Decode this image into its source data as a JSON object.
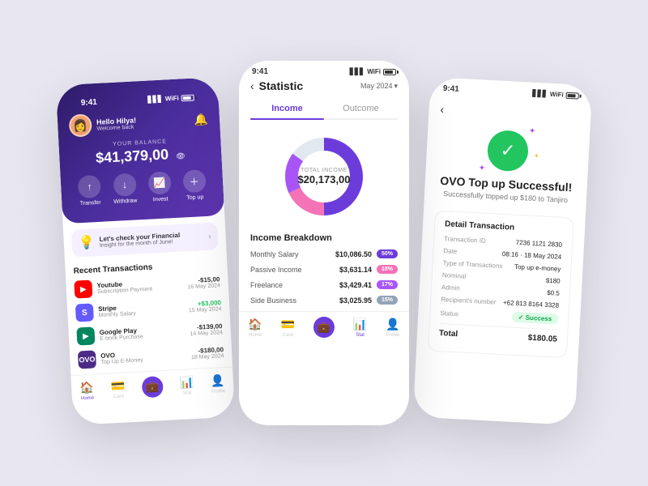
{
  "app": {
    "background": "#e8e6f0"
  },
  "left_phone": {
    "status_time": "9:41",
    "user": {
      "greeting": "Hello Hilya!",
      "sub": "Welcome back",
      "avatar_emoji": "👩"
    },
    "balance": {
      "label": "YOUR BALANCE",
      "amount": "$41,379,00",
      "eye_icon": "👁"
    },
    "actions": [
      {
        "icon": "↑",
        "label": "Transfer"
      },
      {
        "icon": "↓",
        "label": "Withdraw"
      },
      {
        "icon": "📈",
        "label": "Invest"
      },
      {
        "icon": "+",
        "label": "Top up"
      }
    ],
    "insight": {
      "title": "Let's check your Financial",
      "sub": "Insight for the month of June!"
    },
    "recent_title": "Recent Transactions",
    "transactions": [
      {
        "name": "Youtube",
        "sub": "Subscription Payment",
        "amount": "-$15,00",
        "date": "16 May 2024",
        "positive": false,
        "icon": "▶",
        "icon_bg": "#ff0000",
        "icon_color": "#fff"
      },
      {
        "name": "Stripe",
        "sub": "Monthly Salary",
        "amount": "+$3,000",
        "date": "15 May 2024",
        "positive": true,
        "icon": "S",
        "icon_bg": "#635bff",
        "icon_color": "#fff"
      },
      {
        "name": "Google Play",
        "sub": "E-book Purchase",
        "amount": "-$139,00",
        "date": "14 May 2024",
        "positive": false,
        "icon": "▶",
        "icon_bg": "#01875f",
        "icon_color": "#fff"
      },
      {
        "name": "OVO",
        "sub": "Top Up E-Money",
        "amount": "-$180,00",
        "date": "18 May 2024",
        "positive": false,
        "icon": "O",
        "icon_bg": "#4c2a85",
        "icon_color": "#fff"
      }
    ],
    "nav": [
      {
        "icon": "🏠",
        "label": "Home",
        "active": true
      },
      {
        "icon": "💳",
        "label": "Card",
        "active": false
      },
      {
        "icon": "💼",
        "label": "",
        "active": false,
        "wallet": true
      },
      {
        "icon": "📊",
        "label": "Stat",
        "active": false
      },
      {
        "icon": "👤",
        "label": "Profile",
        "active": false
      }
    ]
  },
  "center_phone": {
    "status_time": "9:41",
    "back_label": "‹",
    "title": "Statistic",
    "month": "May 2024",
    "tabs": [
      {
        "label": "Income",
        "active": true
      },
      {
        "label": "Outcome",
        "active": false
      }
    ],
    "donut": {
      "label": "TOTAL INCOME",
      "value": "$20,173,00",
      "segments": [
        {
          "color": "#6c3cdb",
          "percent": 50
        },
        {
          "color": "#f472b6",
          "percent": 18
        },
        {
          "color": "#a855f7",
          "percent": 17
        },
        {
          "color": "#e2e8f0",
          "percent": 15
        }
      ]
    },
    "breakdown_title": "Income Breakdown",
    "breakdown": [
      {
        "name": "Monthly Salary",
        "amount": "$10,086.50",
        "badge": "50%",
        "badge_color": "badge-blue"
      },
      {
        "name": "Passive Income",
        "amount": "$3,631.14",
        "badge": "18%",
        "badge_color": "badge-pink"
      },
      {
        "name": "Freelance",
        "amount": "$3,429.41",
        "badge": "17%",
        "badge_color": "badge-purple"
      },
      {
        "name": "Side Business",
        "amount": "$3,025.95",
        "badge": "15%",
        "badge_color": "badge-gray"
      }
    ],
    "nav": [
      {
        "icon": "🏠",
        "label": "Home",
        "active": false
      },
      {
        "icon": "💳",
        "label": "Card",
        "active": false
      },
      {
        "icon": "💼",
        "label": "",
        "active": false,
        "wallet": true
      },
      {
        "icon": "📊",
        "label": "Stat",
        "active": true
      },
      {
        "icon": "👤",
        "label": "Profile",
        "active": false
      }
    ]
  },
  "right_phone": {
    "status_time": "9:41",
    "back_label": "‹",
    "success_icon": "✓",
    "sparkles": [
      "✦",
      "✦",
      "✦"
    ],
    "title": "OVO Top up Successful!",
    "subtitle": "Successfully topped up $180 to Tanjiro",
    "detail_title": "Detail Transaction",
    "rows": [
      {
        "key": "Transaction ID",
        "value": "7236 1121 2830"
      },
      {
        "key": "Date",
        "value": "08:16 · 18 May 2024"
      },
      {
        "key": "Type of Transactions",
        "value": "Top up e-money"
      },
      {
        "key": "Nominal",
        "value": "$180"
      },
      {
        "key": "Admin",
        "value": "$0.5"
      },
      {
        "key": "Recipient's number",
        "value": "+62 813 8164 3328"
      },
      {
        "key": "Status",
        "value": "✓ Success",
        "is_status": true
      }
    ],
    "total_label": "Total",
    "total_value": "$180.05"
  }
}
